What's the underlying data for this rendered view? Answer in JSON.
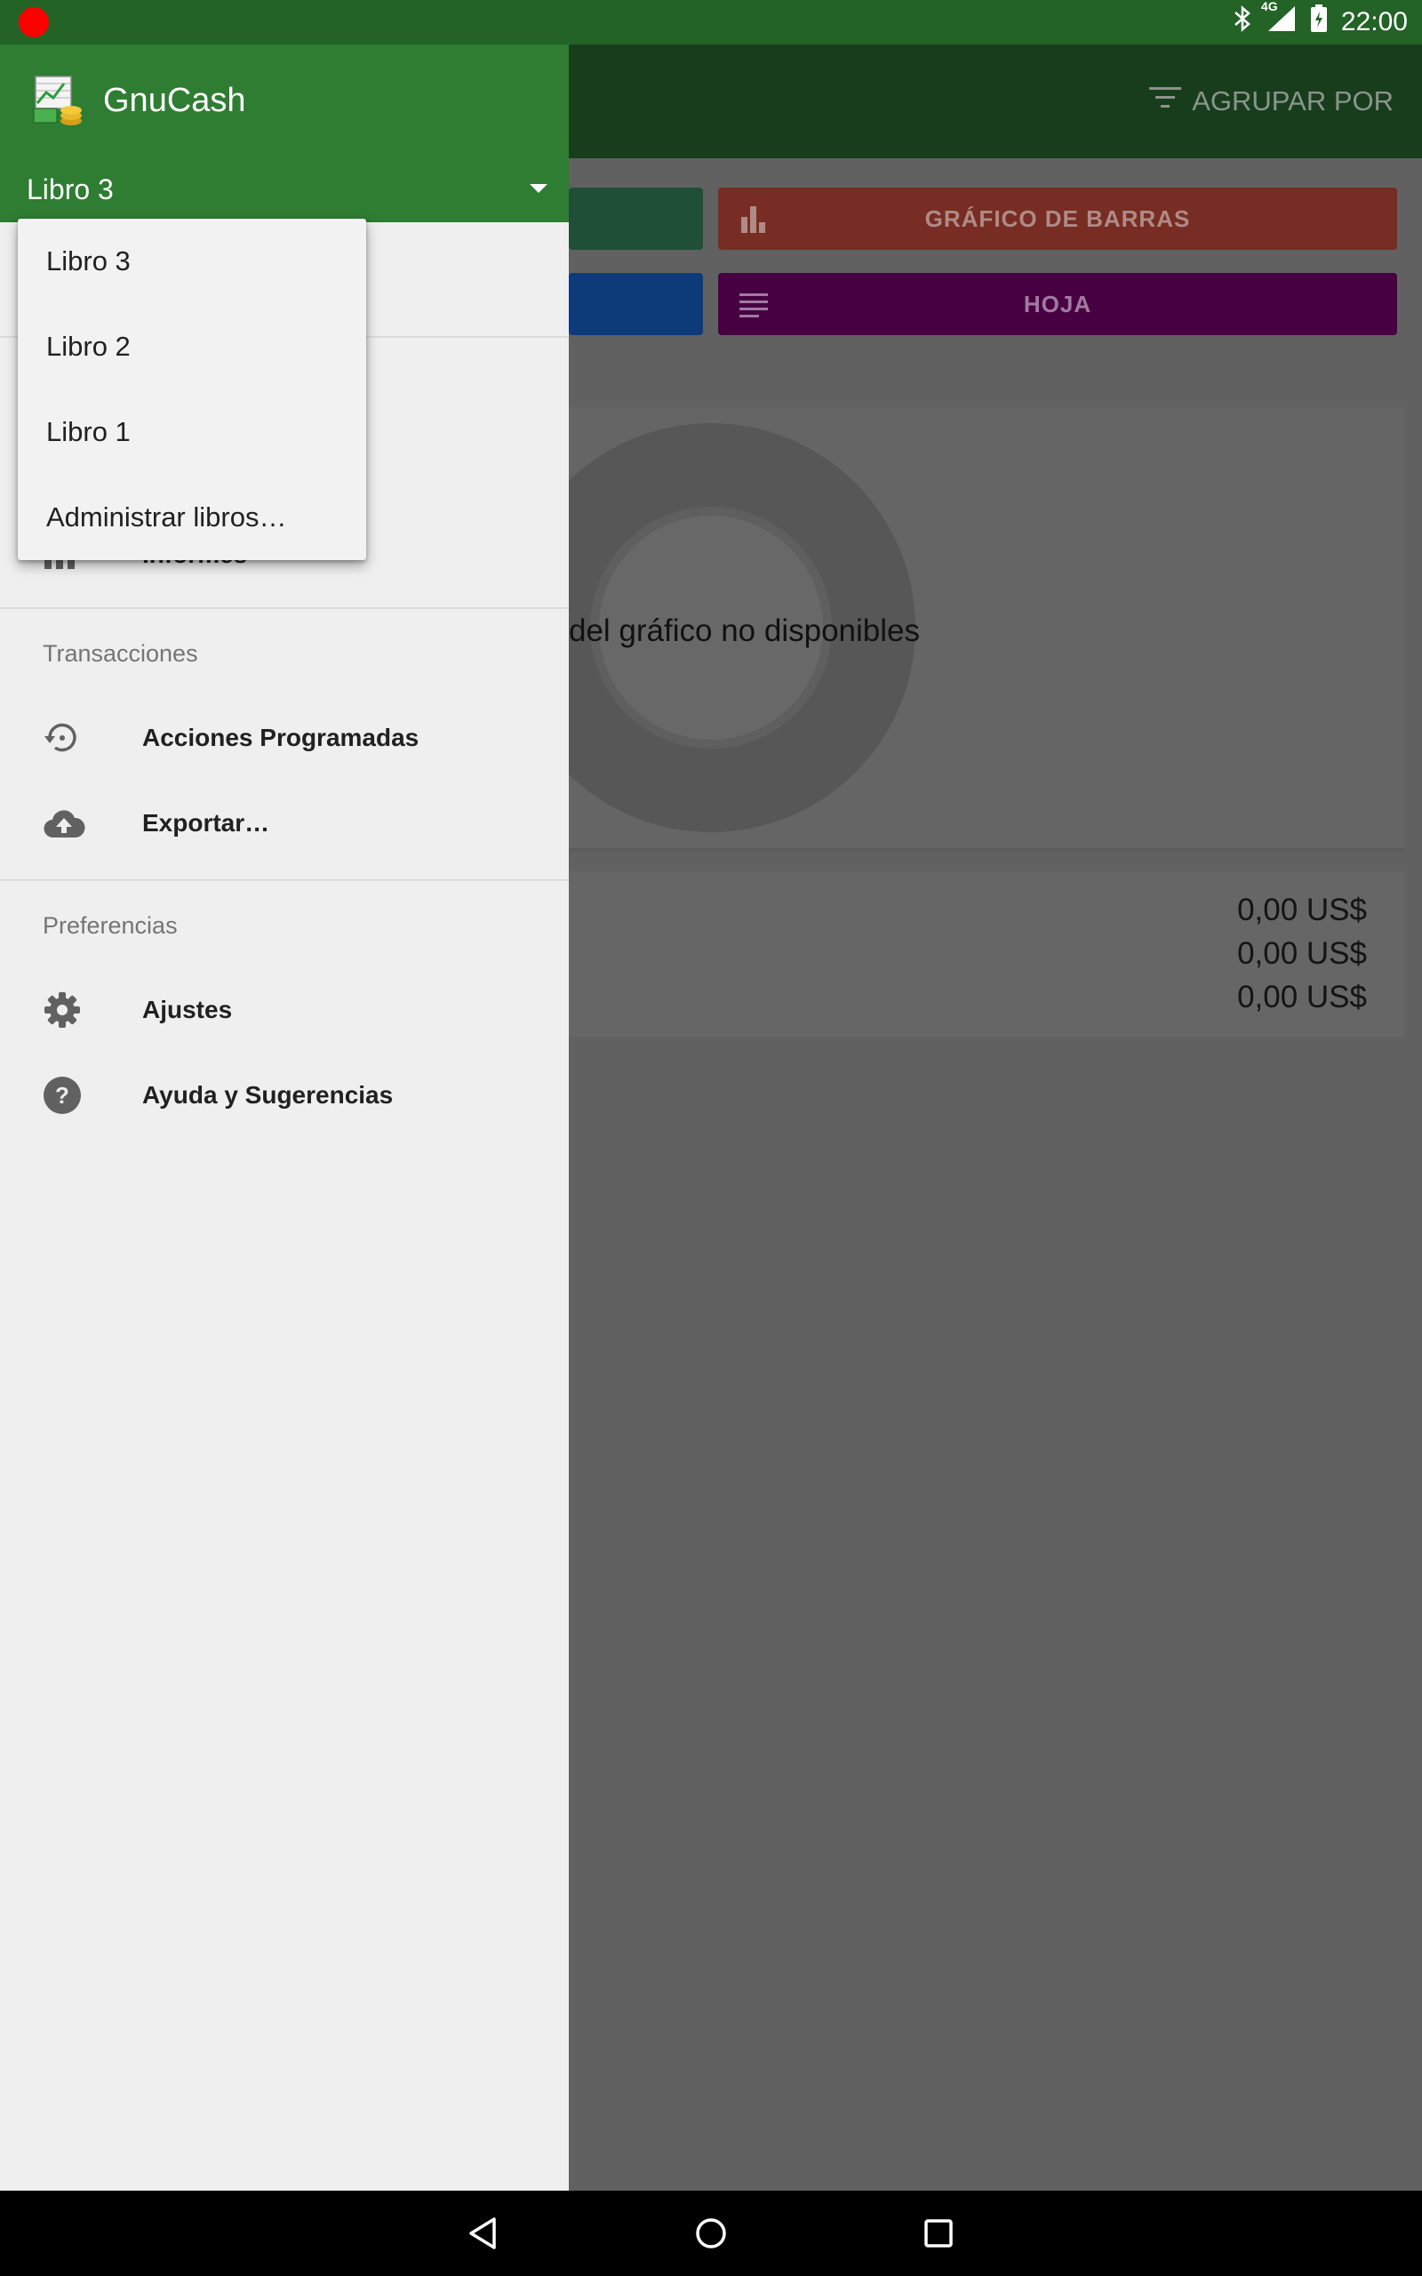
{
  "status_bar": {
    "time": "22:00",
    "network": "4G",
    "icons": [
      "recording-dot-icon",
      "bluetooth-icon",
      "cell-signal-icon",
      "battery-charging-icon"
    ]
  },
  "background_app": {
    "toolbar": {
      "group_by_label": "AGRUPAR POR"
    },
    "tiles": [
      {
        "label": "GRÁFICO DE BARRAS",
        "icon": "bar-chart-icon"
      },
      {
        "label": "HOJA",
        "icon": "sheet-icon"
      }
    ],
    "chart_message": "del gráfico no disponibles",
    "totals": [
      "0,00 US$",
      "0,00 US$",
      "0,00 US$"
    ]
  },
  "drawer": {
    "app_name": "GnuCash",
    "current_book": "Libro 3",
    "hidden_item_partial": "Informes",
    "sections": [
      {
        "title": "Transacciones",
        "items": [
          {
            "label": "Acciones Programadas",
            "icon": "scheduled-history-icon"
          },
          {
            "label": "Exportar…",
            "icon": "cloud-upload-icon"
          }
        ]
      },
      {
        "title": "Preferencias",
        "items": [
          {
            "label": "Ajustes",
            "icon": "gear-icon"
          },
          {
            "label": "Ayuda y Sugerencias",
            "icon": "help-icon"
          }
        ]
      }
    ]
  },
  "book_dropdown": {
    "options": [
      "Libro 3",
      "Libro 2",
      "Libro 1",
      "Administrar libros…"
    ]
  },
  "colors": {
    "primary": "#2e7d32",
    "status_bar": "#236326",
    "drawer_bg": "#efefef",
    "scrim": "#616161"
  }
}
